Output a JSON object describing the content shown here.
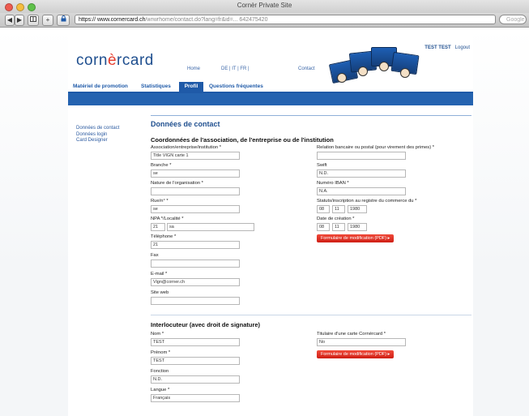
{
  "window": {
    "title": "Cornèr Private Site",
    "url_host": "https:// www.cornercard.ch",
    "url_rest": "/wrwrhome/contact.do?lang=fr&id=... 642475420",
    "search_placeholder": "Google"
  },
  "toolbar": {
    "back": "◀",
    "forward": "▶",
    "plus": "+"
  },
  "site": {
    "logo_a": "corn",
    "logo_b": "è",
    "logo_c": "rcard",
    "topnav": {
      "home": "Home",
      "lang": "DE  |  IT  |  FR  |",
      "contact": "Contact"
    },
    "user": "TEST TEST",
    "logout": "Logout"
  },
  "nav": {
    "items": [
      "Matériel de promotion",
      "Statistiques",
      "Profil",
      "Questions fréquentes"
    ],
    "active": "Profil"
  },
  "sidebar": {
    "items": [
      "Données de contact",
      "Données login",
      "Card Designer"
    ]
  },
  "content": {
    "title": "Données de contact",
    "section1": "Coordonnées de l'association, de l'entreprise ou de l'institution",
    "left": [
      {
        "label": "Association/entreprise/institution *",
        "value": "Title VIGN carte 1"
      },
      {
        "label": "Branche *",
        "value": "se"
      },
      {
        "label": "Nature de l'organisation *",
        "value": ""
      },
      {
        "label": "Rue/n° *",
        "value": "se"
      },
      {
        "label": "NPA */Localité *",
        "value": "21",
        "value2": "sa"
      },
      {
        "label": "Téléphone *",
        "value": "21"
      },
      {
        "label": "Fax",
        "value": ""
      },
      {
        "label": "E-mail *",
        "value": "Vign@corner.ch"
      },
      {
        "label": "Site web",
        "value": ""
      }
    ],
    "right": [
      {
        "label": "Relation bancaire ou postal (pour virement des primes) *",
        "value": ""
      },
      {
        "label": "Swift",
        "value": "N.D."
      },
      {
        "label": "Numéro IBAN *",
        "value": "N.A."
      },
      {
        "label": "Statuts/inscription au registre du commerce du *",
        "d": "08",
        "m": "11",
        "y": "1980"
      },
      {
        "label": "Date de création *",
        "d": "08",
        "m": "11",
        "y": "1980"
      }
    ],
    "pdf_button": "Formulaire de modification (PDF)",
    "section2": "Interlocuteur (avec droit de signature)",
    "contact_left": [
      {
        "label": "Nom *",
        "value": "TEST"
      },
      {
        "label": "Prénom *",
        "value": "TEST"
      },
      {
        "label": "Fonction",
        "value": "N.D."
      },
      {
        "label": "Langue *",
        "value": "Français"
      }
    ],
    "contact_right": [
      {
        "label": "Titulaire d'une carte Cornèrcard *",
        "value": "No"
      }
    ]
  }
}
